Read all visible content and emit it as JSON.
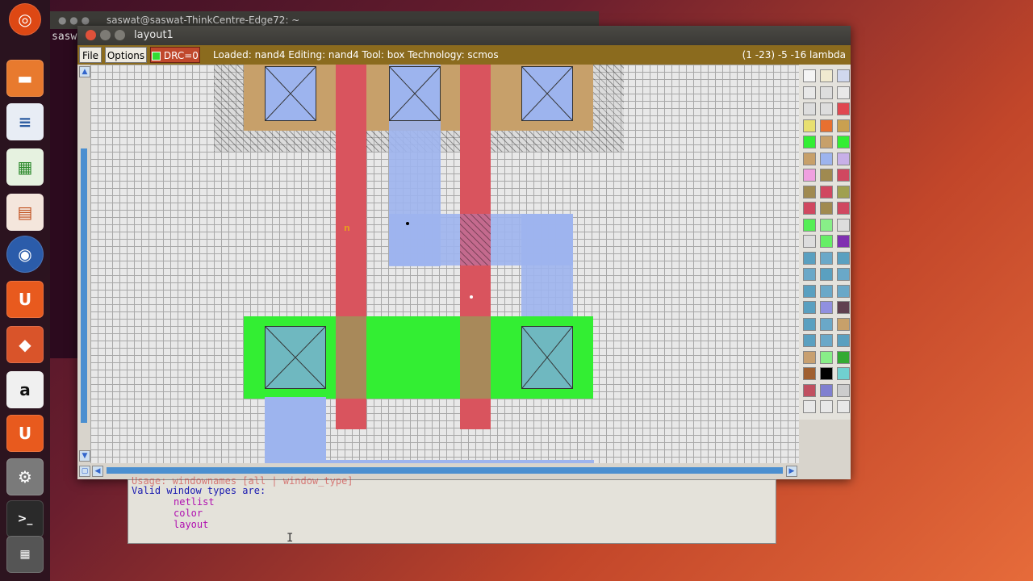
{
  "launcher": {
    "items": [
      "ubuntu-dash",
      "files",
      "writer",
      "calc",
      "impress",
      "firefox",
      "ubuntu-one",
      "software-center",
      "amazon",
      "ubuntu-one-music",
      "system-settings",
      "terminal",
      "workspace-switcher"
    ]
  },
  "bg_terminal": {
    "title": "saswat@saswat-ThinkCentre-Edge72: ~",
    "prompt_fragment": "sasw"
  },
  "window": {
    "title": "layout1",
    "menu": {
      "file": "File",
      "options": "Options",
      "drc": "DRC=0"
    },
    "status": "Loaded: nand4  Editing: nand4  Tool: box   Technology: scmos",
    "coords": "(1 -23) -5 -16 lambda",
    "label_n": "n"
  },
  "console": {
    "line0": "Usage: windownames [all | window_type]",
    "line1": "Valid window types are:",
    "types": [
      "netlist",
      "color",
      "layout"
    ]
  },
  "colors": {
    "poly": "#d9545e",
    "metal1": "#9db4ee",
    "ndiff": "#33ee33",
    "pdiff": "#c7a06a",
    "gate": "#a8895a"
  }
}
